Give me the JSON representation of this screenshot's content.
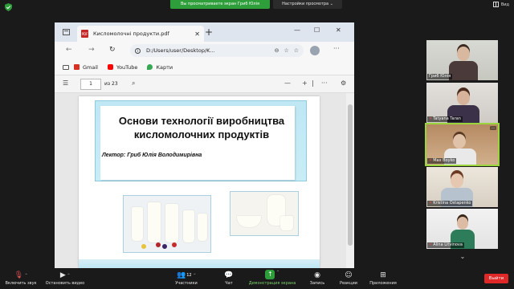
{
  "zoom": {
    "share_banner": "Вы просматриваете экран Гриб Юлія",
    "view_options": "Настройки просмотра",
    "view_mode": "Вид",
    "leave_label": "Выйти",
    "toolbar": [
      {
        "name": "unmute-button",
        "icon": "microphone-muted-icon",
        "label": "Включить звук",
        "glyph": "🎤"
      },
      {
        "name": "start-video-button",
        "icon": "video-camera-icon",
        "label": "Остановить видео",
        "glyph": "■"
      },
      {
        "name": "participants-button",
        "icon": "participants-icon",
        "label": "Участники",
        "glyph": "👥",
        "badge": "12"
      },
      {
        "name": "chat-button",
        "icon": "chat-icon",
        "label": "Чат",
        "glyph": "💬"
      },
      {
        "name": "share-screen-button",
        "icon": "share-screen-icon",
        "label": "Демонстрация экрана",
        "glyph": "↑"
      },
      {
        "name": "record-button",
        "icon": "record-icon",
        "label": "Запись",
        "glyph": "◉"
      },
      {
        "name": "reactions-button",
        "icon": "reactions-icon",
        "label": "Реакции",
        "glyph": "☺"
      },
      {
        "name": "apps-button",
        "icon": "apps-icon",
        "label": "Приложения",
        "glyph": "⊞"
      }
    ],
    "participants": [
      {
        "name": "Гриб Юлія",
        "muted": false
      },
      {
        "name": "Tatyana Taran",
        "muted": true
      },
      {
        "name": "Max Boyko",
        "muted": true,
        "active": true
      },
      {
        "name": "Kristina Ostapenko",
        "muted": true
      },
      {
        "name": "Alina Litvinova",
        "muted": true
      }
    ]
  },
  "browser": {
    "tab_title": "Кисломолочні продукти.pdf",
    "url": "D:/Users/user/Desktop/K...",
    "favorites": [
      {
        "label": "Gmail",
        "icon": "gmail-icon",
        "color": "#d93025"
      },
      {
        "label": "YouTube",
        "icon": "youtube-icon",
        "color": "#ff0000"
      },
      {
        "label": "Карти",
        "icon": "maps-icon",
        "color": "#34a853"
      }
    ],
    "pdf": {
      "page_current": "1",
      "page_total": "из 23"
    }
  },
  "slide": {
    "title": "Основи технології виробництва кисломолочних продуктів",
    "lector": "Лектор: Гриб Юлія Володимирівна"
  }
}
